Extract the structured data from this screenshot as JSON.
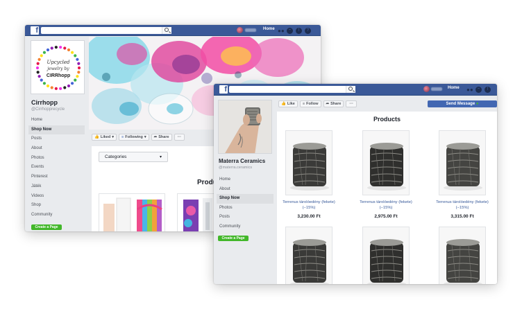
{
  "colors": {
    "fb_blue": "#3b5998",
    "link_blue": "#365899",
    "green": "#42b72a",
    "button_blue": "#4267b2",
    "gray_bg": "#e9ebee"
  },
  "page1": {
    "topbar": {
      "logo": "f",
      "search_icon": "search-icon",
      "home": "Home"
    },
    "logo_text": {
      "line1": "Upcycled",
      "line2": "jewelry by",
      "brand": "CIRRhopp"
    },
    "page_name": "Cirrhopp",
    "handle": "@Cirrhopprecycle",
    "nav": [
      "Home",
      "Shop Now",
      "Posts",
      "About",
      "Photos",
      "Events",
      "Pinterest",
      "Játék",
      "Videos",
      "Shop",
      "Community"
    ],
    "active_nav": "Shop Now",
    "create_page": "Create a Page",
    "actions": {
      "liked": "Liked",
      "following": "Following",
      "share": "Share",
      "more": "···"
    },
    "categories": "Categories",
    "products_heading_partial": "Produ"
  },
  "page2": {
    "topbar": {
      "logo": "f",
      "search_icon": "search-icon",
      "home": "Home"
    },
    "page_name": "Materra Ceramics",
    "handle": "@materra.ceramics",
    "nav": [
      "Home",
      "About",
      "Shop Now",
      "Photos",
      "Posts",
      "Community"
    ],
    "active_nav": "Shop Now",
    "create_page": "Create a Page",
    "actions": {
      "like": "Like",
      "follow": "Follow",
      "share": "Share",
      "more": "···"
    },
    "send_message": "Send Message",
    "products_heading": "Products",
    "products": [
      {
        "name": "Terrenus tárolóedény (fekete) (−15%)",
        "price": "3,230.00 Ft"
      },
      {
        "name": "Terrenus tárolóedény (fekete) (−15%)",
        "price": "2,975.00 Ft"
      },
      {
        "name": "Terrenus tárolóedény (fekete) (−15%)",
        "price": "3,315.00 Ft"
      },
      {
        "name": "",
        "price": ""
      },
      {
        "name": "",
        "price": ""
      },
      {
        "name": "",
        "price": ""
      }
    ]
  }
}
